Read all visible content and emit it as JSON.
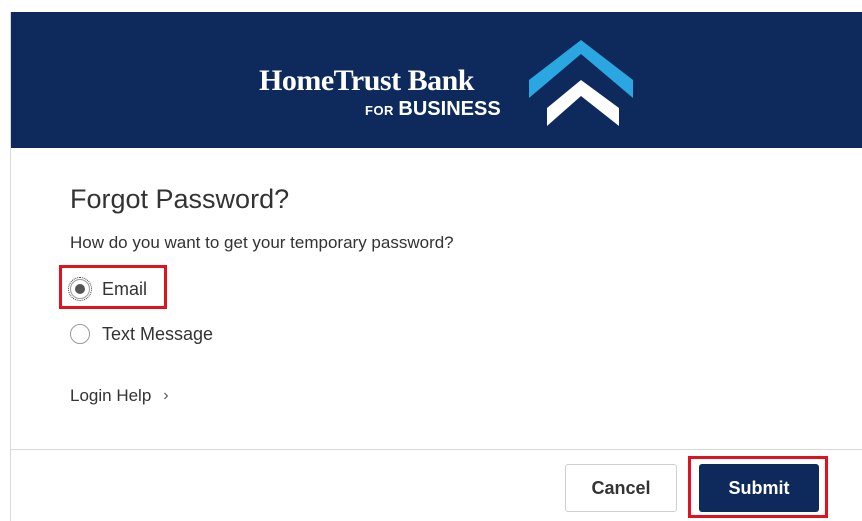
{
  "header": {
    "brand_name": "HomeTrust Bank",
    "brand_sub_small": "FOR",
    "brand_sub_big": "BUSINESS",
    "logo_icon": "hometrust-roof-logo-icon",
    "background_color": "#0e2a5c",
    "logo_accent_color": "#2aa6e0"
  },
  "form": {
    "title": "Forgot Password?",
    "question": "How do you want to get your temporary password?",
    "options": [
      {
        "label": "Email",
        "selected": true
      },
      {
        "label": "Text Message",
        "selected": false
      }
    ],
    "login_help_label": "Login Help",
    "login_help_icon": "chevron-right-icon"
  },
  "actions": {
    "cancel_label": "Cancel",
    "submit_label": "Submit",
    "submit_color": "#0e2a5c",
    "highlight_color": "#e0121f"
  }
}
